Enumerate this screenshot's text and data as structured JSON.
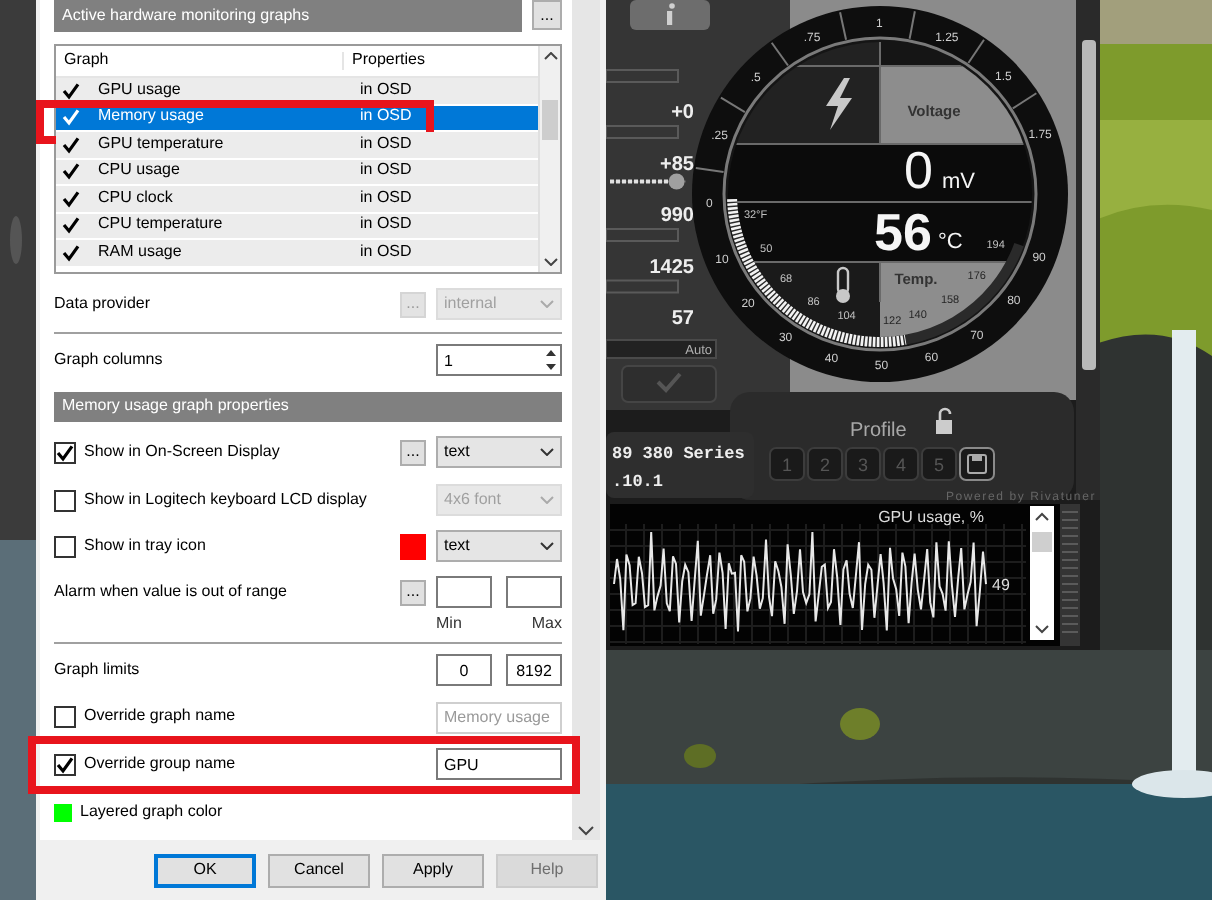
{
  "dialog": {
    "section_header": "Active hardware monitoring graphs",
    "section_button": "...",
    "graphs_table": {
      "columns": [
        "Graph",
        "Properties"
      ],
      "rows": [
        {
          "graph": "GPU usage",
          "properties": "in OSD",
          "checked": true,
          "selected": false,
          "highlighted": false
        },
        {
          "graph": "Memory usage",
          "properties": "in OSD",
          "checked": true,
          "selected": true,
          "highlighted": true
        },
        {
          "graph": "GPU temperature",
          "properties": "in OSD",
          "checked": true,
          "selected": false,
          "highlighted": false
        },
        {
          "graph": "CPU usage",
          "properties": "in OSD",
          "checked": true,
          "selected": false,
          "highlighted": false
        },
        {
          "graph": "CPU clock",
          "properties": "in OSD",
          "checked": true,
          "selected": false,
          "highlighted": false
        },
        {
          "graph": "CPU temperature",
          "properties": "in OSD",
          "checked": true,
          "selected": false,
          "highlighted": false
        },
        {
          "graph": "RAM usage",
          "properties": "in OSD",
          "checked": true,
          "selected": false,
          "highlighted": false
        }
      ]
    },
    "data_provider": {
      "label": "Data provider",
      "button": "...",
      "value": "internal",
      "disabled": true
    },
    "graph_columns": {
      "label": "Graph columns",
      "value": "1"
    },
    "properties_header": "Memory usage graph properties",
    "properties": [
      {
        "kind": "check-select",
        "label": "Show in On-Screen Display",
        "checked": true,
        "button": "...",
        "value": "text",
        "disabled": false,
        "highlighted": false
      },
      {
        "kind": "check-select",
        "label": "Show in Logitech keyboard LCD display",
        "checked": false,
        "value": "4x6 font",
        "disabled": true,
        "highlighted": false
      },
      {
        "kind": "check-select",
        "label": "Show in tray icon",
        "checked": false,
        "color": "#ff0000",
        "value": "text",
        "disabled": false,
        "highlighted": false
      },
      {
        "kind": "alarm",
        "label": "Alarm when value is out of range",
        "button": "...",
        "captions": [
          "Min",
          "Max"
        ],
        "highlighted": false
      },
      {
        "kind": "limits",
        "label": "Graph limits",
        "values": [
          "0",
          "8192"
        ],
        "highlighted": false
      },
      {
        "kind": "check-input",
        "label": "Override graph name",
        "checked": false,
        "value": "Memory usage",
        "disabled": true,
        "highlighted": false
      },
      {
        "kind": "check-input",
        "label": "Override group name",
        "checked": true,
        "value": "GPU",
        "disabled": false,
        "highlighted": true
      },
      {
        "kind": "color",
        "label": "Layered graph color",
        "color": "#00ff00",
        "highlighted": false
      }
    ],
    "buttons": [
      {
        "label": "OK",
        "default": true,
        "disabled": false
      },
      {
        "label": "Cancel",
        "default": false,
        "disabled": false
      },
      {
        "label": "Apply",
        "default": false,
        "disabled": false
      },
      {
        "label": "Help",
        "default": false,
        "disabled": true
      }
    ]
  },
  "afterburner": {
    "readouts": [
      {
        "value": "+0"
      },
      {
        "value": "+85",
        "level": 0.9
      },
      {
        "value": "990"
      },
      {
        "value": "1425"
      },
      {
        "value": "57",
        "mode": "Auto"
      }
    ],
    "gauge": {
      "voltage_scale": [
        "0",
        ".25",
        ".5",
        ".75",
        "1",
        "1.25",
        "1.5",
        "1.75"
      ],
      "voltage_label": "Voltage",
      "voltage_value": "0",
      "voltage_unit": "mV",
      "temp_value": "56",
      "temp_unit": "°C",
      "temp_label": "Temp.",
      "temp_scale_c": [
        "10",
        "20",
        "30",
        "40",
        "50",
        "60",
        "70",
        "80",
        "90"
      ],
      "temp_scale_f": [
        "32°F",
        "50",
        "68",
        "86",
        "104",
        "122",
        "140",
        "158",
        "176",
        "194"
      ],
      "level": 0.62
    },
    "profile_label": "Profile",
    "profiles": [
      "1",
      "2",
      "3",
      "4",
      "5"
    ],
    "card_name": "89 380 Series",
    "version": ".10.1",
    "credit": "Powered by Rivatuner",
    "graph": {
      "title": "GPU usage, %",
      "value": "49"
    }
  }
}
